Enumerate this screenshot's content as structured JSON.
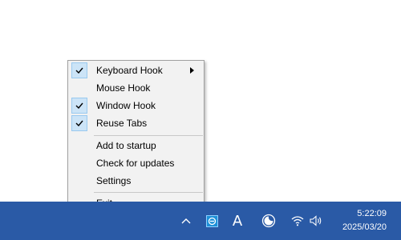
{
  "context_menu": {
    "items": [
      {
        "label": "Keyboard Hook",
        "checked": true,
        "submenu": true
      },
      {
        "label": "Mouse Hook",
        "checked": false,
        "submenu": false
      },
      {
        "label": "Window Hook",
        "checked": true,
        "submenu": false
      },
      {
        "label": "Reuse Tabs",
        "checked": true,
        "submenu": false
      },
      {
        "label": "Add to startup",
        "checked": false,
        "submenu": false
      },
      {
        "label": "Check for updates",
        "checked": false,
        "submenu": false
      },
      {
        "label": "Settings",
        "checked": false,
        "submenu": false
      },
      {
        "label": "Exit",
        "checked": false,
        "submenu": false
      }
    ]
  },
  "taskbar": {
    "ime_indicator": "A",
    "clock": {
      "time": "5:22:09",
      "date": "2025/03/20"
    },
    "icons": [
      "chevron-up-icon",
      "app-tray-icon",
      "focus-assist-icon",
      "wifi-icon",
      "volume-icon"
    ]
  },
  "colors": {
    "taskbar": "#2a5aa6",
    "menu_background": "#f2f2f2",
    "check_highlight": "#cce4f7",
    "check_border": "#99c9ef"
  }
}
